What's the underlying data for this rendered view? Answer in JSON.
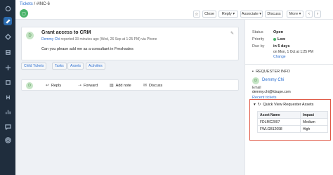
{
  "breadcrumb": {
    "parent": "Tickets",
    "separator": " / ",
    "current": "#INC-6"
  },
  "toolbar": {
    "close_label": "Close",
    "reply_label": "Reply",
    "associate_label": "Associate",
    "discuss_label": "Discuss",
    "more_label": "More"
  },
  "ticket": {
    "title": "Grant access to CRM",
    "requester": "Demmy Chi",
    "meta": " reported 33 minutes ago (Wed, 26 Sep at 1:25 PM) via Phone",
    "body": "Can you please add me as a consultant in Freshsales"
  },
  "tabs": [
    "Child Tickets",
    "Tasks",
    "Assets",
    "Activities"
  ],
  "reply_bar": {
    "reply": "Reply",
    "forward": "Forward",
    "add_note": "Add note",
    "discuss": "Discuss"
  },
  "properties": {
    "status_label": "Status",
    "status_value": "Open",
    "priority_label": "Priority",
    "priority_value": "Low",
    "due_label": "Due by",
    "due_value": "in 5 days",
    "due_sub": "on Mon, 1 Oct at 1:25 PM",
    "change_label": "Change",
    "priority_color": "#49b36a"
  },
  "requester": {
    "section_title": "REQUESTER INFO",
    "name": "Demmy Chi",
    "email_label": "Email",
    "email": "demmy.chi@fdsupe.com",
    "recent_tickets": "Recent tickets"
  },
  "quick_view": {
    "title": "Quick View Requester Assets",
    "columns": [
      "Asset Name",
      "Impact"
    ],
    "rows": [
      [
        "FDLMC2007",
        "Medium"
      ],
      [
        "FWLGB12098",
        "High"
      ]
    ],
    "highlight_color": "#e05a47"
  }
}
